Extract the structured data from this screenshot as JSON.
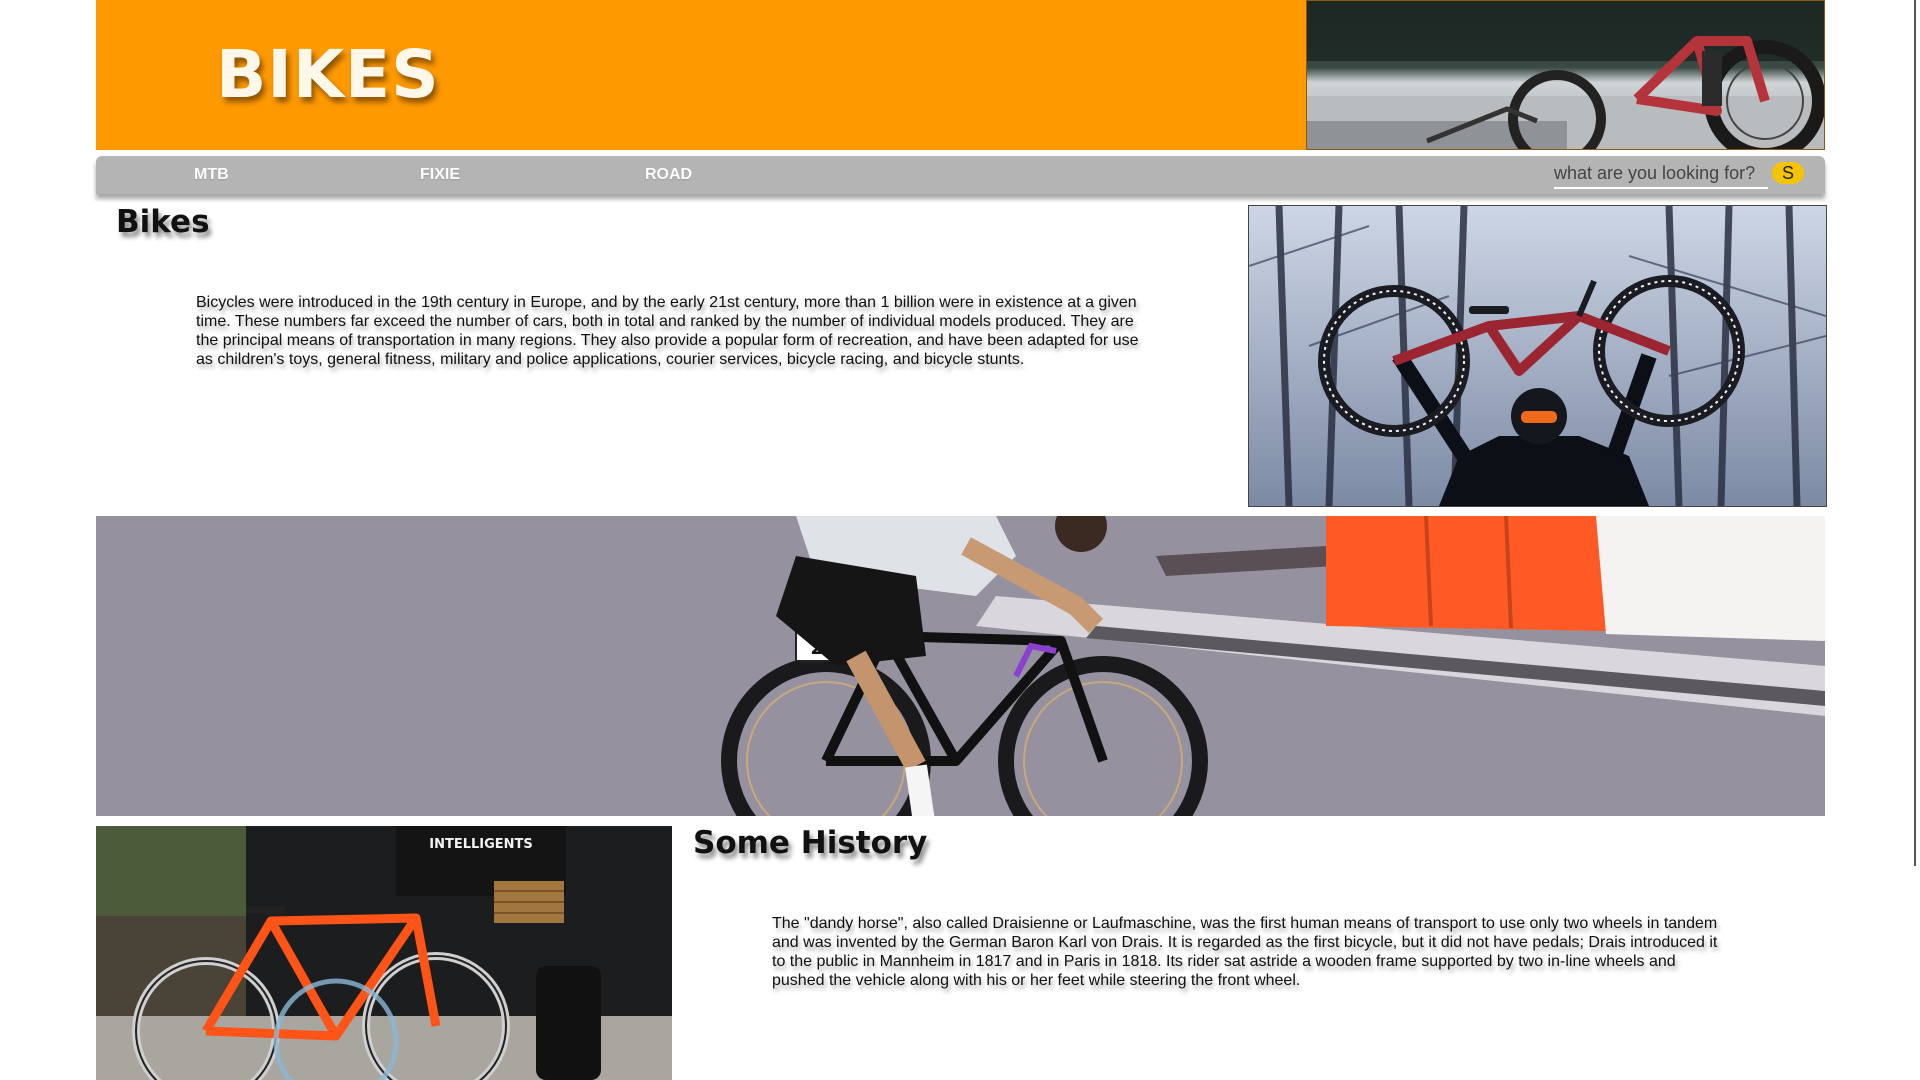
{
  "header": {
    "title": "BIKES"
  },
  "nav": {
    "links": [
      "MTB",
      "FIXIE",
      "ROAD"
    ],
    "search_placeholder": "what are you looking for?",
    "search_button": "S"
  },
  "intro": {
    "heading": "Bikes",
    "text": "Bicycles were introduced in the 19th century in Europe, and by the early 21st century, more than 1 billion were in existence at a given time. These numbers far exceed the number of cars, both in total and ranked by the number of individual models produced. They are the principal means of transportation in many regions. They also provide a popular form of recreation, and have been adapted for use as children's toys, general fitness, military and police applications, courier services, bicycle racing, and bicycle stunts."
  },
  "history": {
    "heading": "Some History",
    "text": "The \"dandy horse\", also called Draisienne or Laufmaschine, was the first human means of transport to use only two wheels in tandem and was invented by the German Baron Karl von Drais. It is regarded as the first bicycle, but it did not have pedals; Drais introduced it to the public in Mannheim in 1817 and in Paris in 1818. Its rider sat astride a wooden frame supported by two in-line wheels and pushed the vehicle along with his or her feet while steering the front wheel."
  },
  "photos": {
    "race_number": "26",
    "shop_sign": "INTELLIGENTS"
  },
  "colors": {
    "header_bg": "#ff9900",
    "nav_bg": "#b4b4b4",
    "search_button_bg": "#f5c400"
  }
}
